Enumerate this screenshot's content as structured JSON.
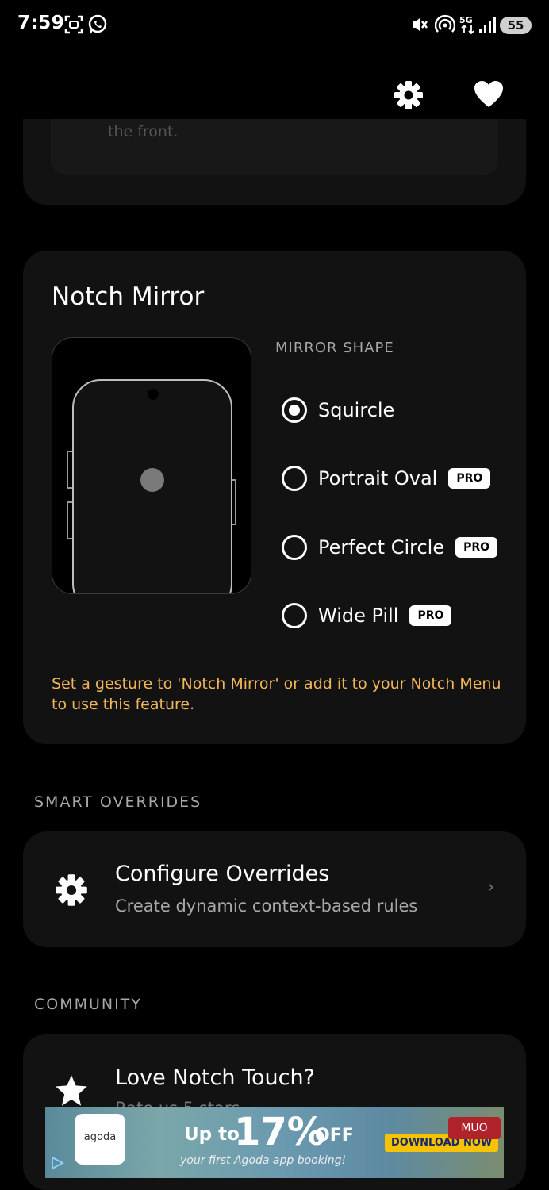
{
  "status": {
    "time": "7:59",
    "battery": "55",
    "left_icons": [
      "screenshot-icon",
      "whatsapp-icon"
    ],
    "right_icons": [
      "mute-vibrate-icon",
      "hotspot-icon",
      "5g-icon",
      "signal-icon"
    ]
  },
  "topbar": {
    "icons": [
      "gear-icon",
      "heart-icon"
    ]
  },
  "previous_card": {
    "faded_text": "the front."
  },
  "notch_mirror": {
    "title": "Notch Mirror",
    "mirror_shape_label": "MIRROR SHAPE",
    "options": [
      {
        "label": "Squircle",
        "selected": true,
        "pro": false
      },
      {
        "label": "Portrait Oval",
        "selected": false,
        "pro": true
      },
      {
        "label": "Perfect Circle",
        "selected": false,
        "pro": true
      },
      {
        "label": "Wide Pill",
        "selected": false,
        "pro": true
      }
    ],
    "pro_label": "PRO",
    "hint": "Set a gesture to 'Notch Mirror' or add it to your Notch Menu to use this feature.",
    "hint_color": "#f2b55a"
  },
  "smart_overrides": {
    "section_label": "SMART OVERRIDES",
    "title": "Configure Overrides",
    "subtitle": "Create dynamic context-based rules",
    "chevron": "›"
  },
  "community": {
    "section_label": "COMMUNITY",
    "title": "Love Notch Touch?",
    "subtitle": "Rate us 5 stars"
  },
  "ad": {
    "brand": "agoda",
    "up_to": "Up to",
    "percent": "17%",
    "off": "OFF",
    "subtitle": "your first Agoda app booking!",
    "cta": "DOWNLOAD NOW",
    "badge": "MUO"
  }
}
